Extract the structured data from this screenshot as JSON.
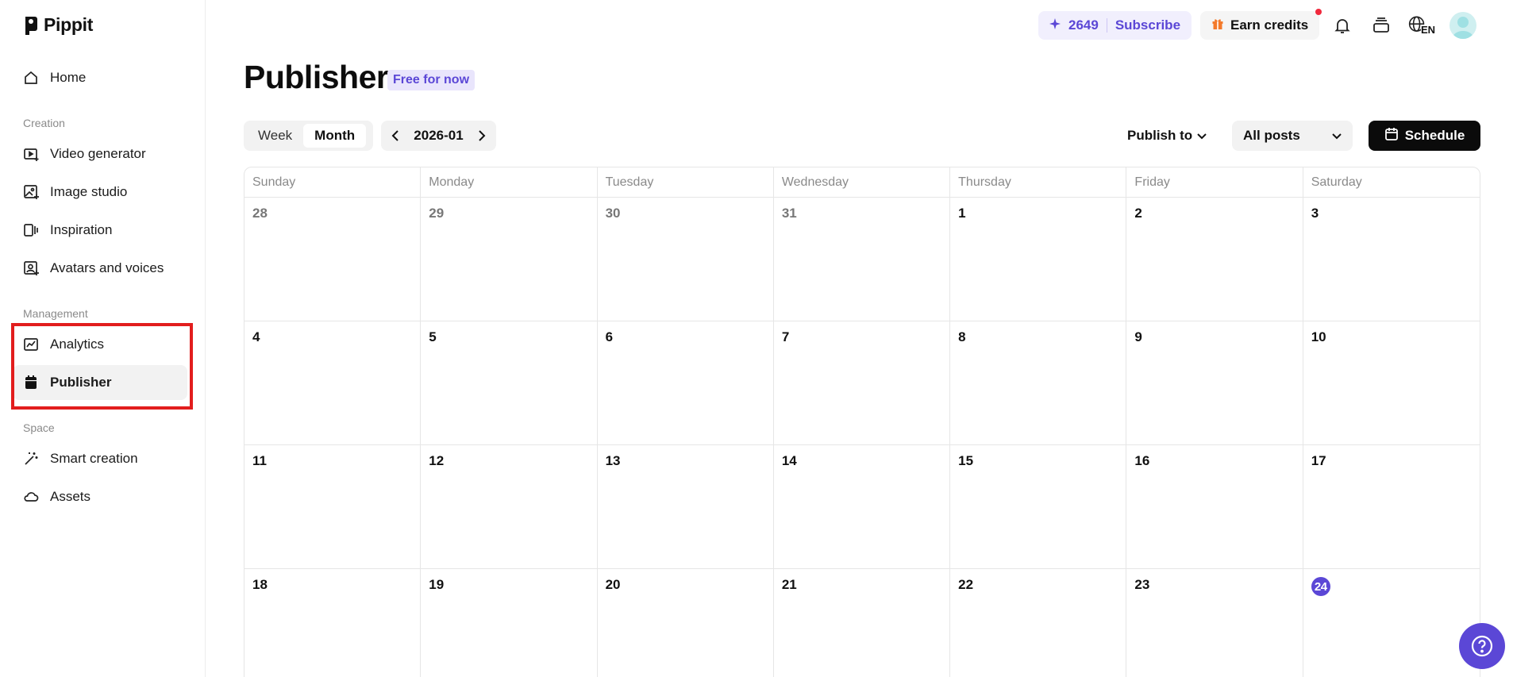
{
  "app": {
    "name": "Pippit"
  },
  "sidebar": {
    "home_label": "Home",
    "section_creation": "Creation",
    "section_management": "Management",
    "section_space": "Space",
    "items": [
      {
        "label": "Video generator",
        "icon": "video-plus-icon"
      },
      {
        "label": "Image studio",
        "icon": "image-plus-icon"
      },
      {
        "label": "Inspiration",
        "icon": "inspiration-icon"
      },
      {
        "label": "Avatars and voices",
        "icon": "avatar-icon"
      },
      {
        "label": "Analytics",
        "icon": "chart-icon"
      },
      {
        "label": "Publisher",
        "icon": "calendar-icon",
        "active": true
      },
      {
        "label": "Smart creation",
        "icon": "magic-wand-icon"
      },
      {
        "label": "Assets",
        "icon": "cloud-icon"
      }
    ]
  },
  "topbar": {
    "credits": "2649",
    "subscribe_label": "Subscribe",
    "earn_label": "Earn credits",
    "language": "EN"
  },
  "header": {
    "title": "Publisher",
    "badge": "Free for now"
  },
  "toolbar": {
    "view_week": "Week",
    "view_month": "Month",
    "month_label": "2026-01",
    "publish_to_label": "Publish to",
    "posts_filter_value": "All posts",
    "schedule_label": "Schedule"
  },
  "calendar": {
    "weekdays": [
      "Sunday",
      "Monday",
      "Tuesday",
      "Wednesday",
      "Thursday",
      "Friday",
      "Saturday"
    ],
    "days": [
      {
        "d": "28",
        "m": true
      },
      {
        "d": "29",
        "m": true
      },
      {
        "d": "30",
        "m": true
      },
      {
        "d": "31",
        "m": true
      },
      {
        "d": "1"
      },
      {
        "d": "2"
      },
      {
        "d": "3"
      },
      {
        "d": "4"
      },
      {
        "d": "5"
      },
      {
        "d": "6"
      },
      {
        "d": "7"
      },
      {
        "d": "8"
      },
      {
        "d": "9"
      },
      {
        "d": "10"
      },
      {
        "d": "11"
      },
      {
        "d": "12"
      },
      {
        "d": "13"
      },
      {
        "d": "14"
      },
      {
        "d": "15"
      },
      {
        "d": "16"
      },
      {
        "d": "17"
      },
      {
        "d": "18"
      },
      {
        "d": "19"
      },
      {
        "d": "20"
      },
      {
        "d": "21"
      },
      {
        "d": "22"
      },
      {
        "d": "23"
      },
      {
        "d": "24",
        "today": true
      }
    ]
  },
  "colors": {
    "accent": "#5b47d6",
    "highlight": "#e21d1d"
  }
}
